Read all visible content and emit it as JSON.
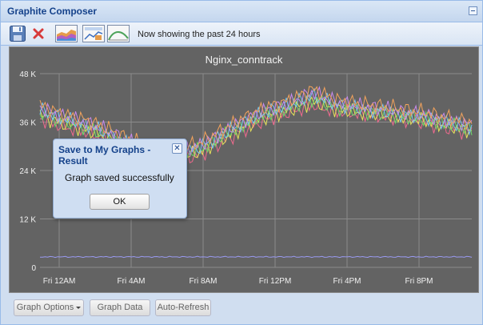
{
  "window": {
    "title": "Graphite Composer"
  },
  "toolbar": {
    "status_text": "Now showing the past 24 hours",
    "icons": [
      "save-icon",
      "delete-icon",
      "graph-type-icon",
      "graph-options-icon",
      "line-graph-icon"
    ]
  },
  "chart_data": {
    "type": "line",
    "title": "Nginx_conntrack",
    "x_tick_labels": [
      "Fri 12AM",
      "Fri  4AM",
      "Fri  8AM",
      "Fri 12PM",
      "Fri  4PM",
      "Fri  8PM"
    ],
    "y_tick_labels": [
      "0",
      "12 K",
      "24 K",
      "36 K",
      "48 K"
    ],
    "ylim": [
      0,
      48000
    ],
    "grid": true,
    "legend": "none",
    "background_color": "#636363",
    "series": [
      {
        "color": "#f06a8e",
        "values": [
          36800,
          34800,
          33600,
          31200,
          28400,
          26800,
          26400,
          27800,
          31000,
          34200,
          36800,
          38400,
          40200,
          38600,
          38000,
          37400,
          36600,
          35800,
          34400,
          33400
        ]
      },
      {
        "color": "#e7e35a",
        "values": [
          37600,
          35600,
          34200,
          31800,
          29200,
          27400,
          27000,
          28400,
          31600,
          34800,
          37400,
          39000,
          41000,
          39200,
          38400,
          37800,
          37000,
          36200,
          34800,
          33800
        ]
      },
      {
        "color": "#6cd96c",
        "values": [
          38400,
          36200,
          34800,
          32600,
          29800,
          28000,
          27600,
          29000,
          32200,
          35400,
          38000,
          39600,
          41800,
          39800,
          38800,
          38200,
          37400,
          36600,
          35200,
          34200
        ]
      },
      {
        "color": "#76c6f2",
        "values": [
          39000,
          36800,
          35400,
          33200,
          30400,
          28600,
          28200,
          29600,
          32800,
          36000,
          38600,
          40200,
          42600,
          40400,
          39400,
          38800,
          38000,
          37200,
          35800,
          34800
        ]
      },
      {
        "color": "#c98af0",
        "values": [
          39600,
          37400,
          36000,
          33800,
          31000,
          29200,
          28800,
          30200,
          33400,
          36600,
          39200,
          40800,
          43400,
          41000,
          40000,
          39400,
          38600,
          37800,
          36400,
          35400
        ]
      },
      {
        "color": "#f3a35c",
        "values": [
          40200,
          38000,
          36600,
          34400,
          31600,
          29800,
          29400,
          30800,
          34000,
          37200,
          39800,
          41400,
          44200,
          41600,
          40600,
          40000,
          39200,
          38400,
          37000,
          36000
        ]
      },
      {
        "color": "#9a9af2",
        "values": [
          2600,
          2600,
          2600,
          2600,
          2600,
          2600,
          2600,
          2600,
          2600,
          2600,
          2600,
          2600,
          2600,
          2600,
          2600,
          2600,
          2600,
          2600,
          2600,
          2600
        ]
      }
    ]
  },
  "dialog": {
    "title": "Save to My Graphs - Result",
    "close_label": "✕",
    "message": "Graph saved successfully",
    "ok_label": "OK"
  },
  "bottom_bar": {
    "graph_options_label": "Graph Options",
    "graph_data_label": "Graph Data",
    "auto_refresh_label": "Auto-Refresh"
  }
}
